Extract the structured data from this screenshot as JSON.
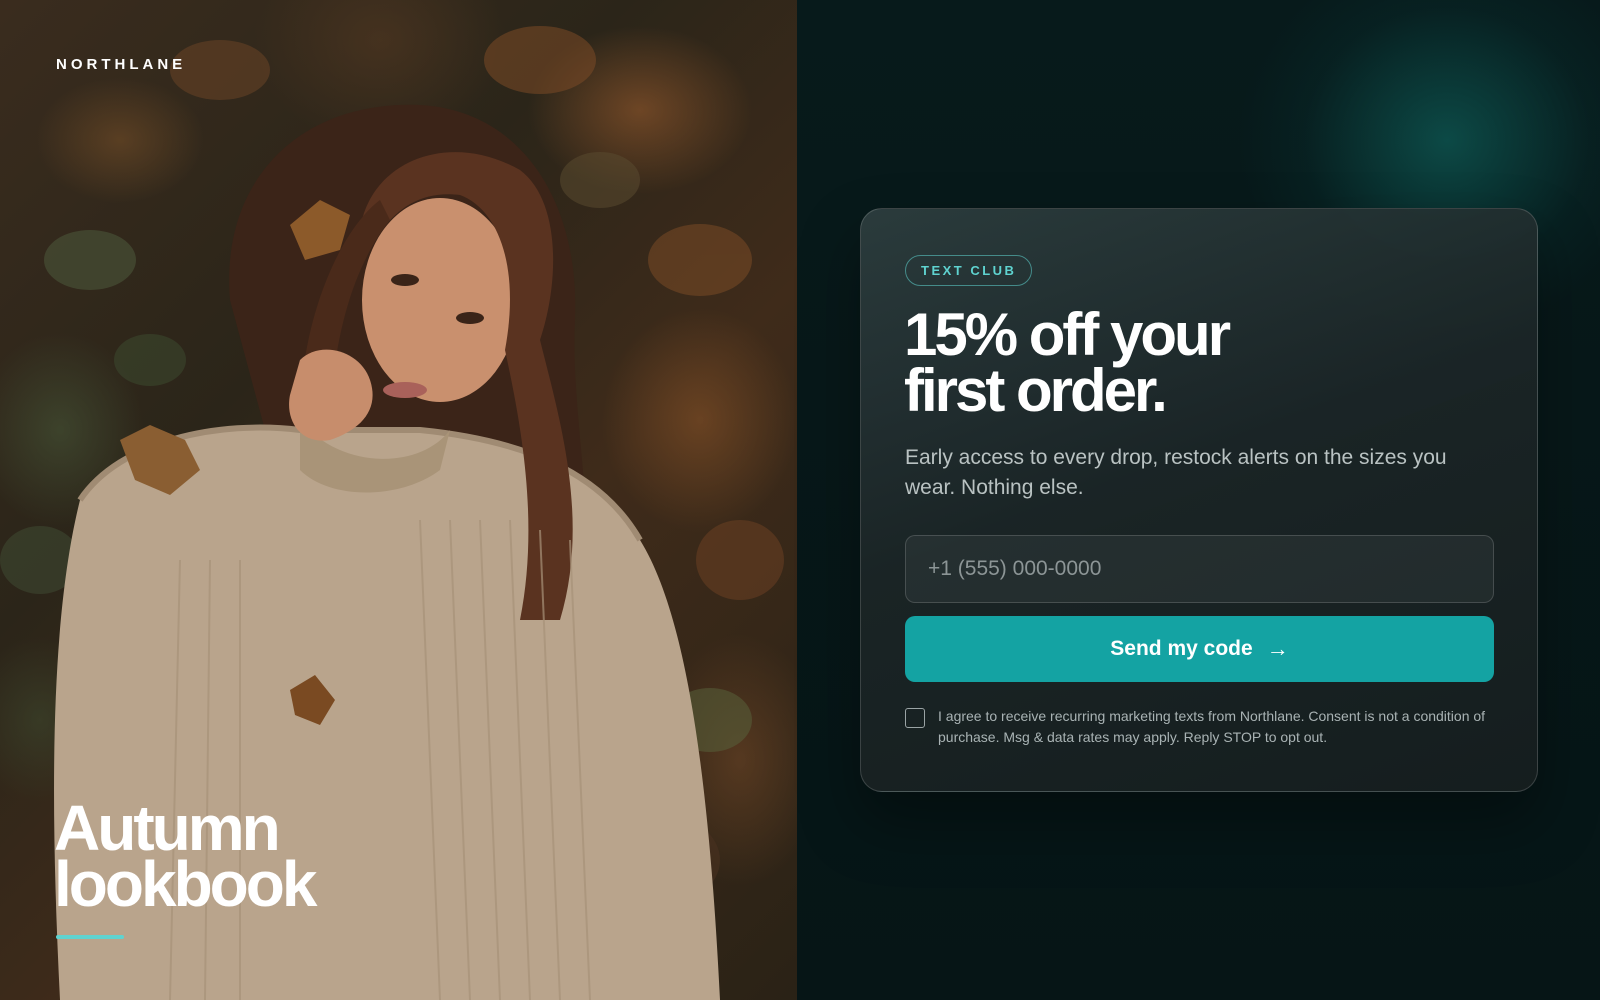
{
  "brand": {
    "name": "NORTHLANE"
  },
  "hero": {
    "title_line1": "Autumn",
    "title_line2": "lookbook"
  },
  "signup": {
    "badge": "TEXT CLUB",
    "headline_line1": "15% off your",
    "headline_line2": "first order.",
    "description": "Early access to every drop, restock alerts on the sizes you wear. Nothing else.",
    "phone_placeholder": "+1 (555) 000-0000",
    "phone_value": "",
    "submit_label": "Send my code",
    "submit_arrow": "→",
    "consent_checked": false,
    "consent_text": "I agree to receive recurring marketing texts from Northlane. Consent is not a condition of purchase. Msg & data rates may apply. Reply STOP to opt out."
  },
  "colors": {
    "accent": "#14a3a3",
    "accent_light": "#5fd3d0",
    "background": "#07181a"
  },
  "icons": {
    "submit_arrow_icon": "right-arrow-icon"
  }
}
